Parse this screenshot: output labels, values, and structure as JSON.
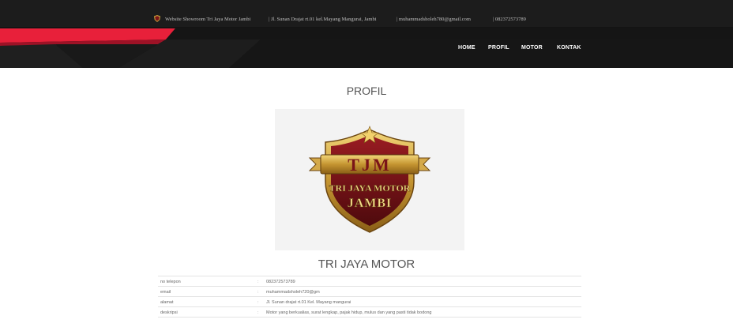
{
  "topbar": {
    "site": "Website Showroom Tri Jaya Motor Jambi",
    "address": "| Jl. Sunan Drajat rt.01 kel.Mayang Mangurai, Jambi",
    "email": "| muhammadsholeh780@gmail.com",
    "phone": "| 082372573789"
  },
  "nav": {
    "items": [
      {
        "label": "HOME"
      },
      {
        "label": "PROFIL"
      },
      {
        "label": "MOTOR"
      },
      {
        "label": "KONTAK"
      }
    ]
  },
  "page": {
    "title": "PROFIL",
    "brand": "TRI JAYA MOTOR"
  },
  "logo": {
    "initials": "TJM",
    "line1": "TRI JAYA MOTOR",
    "line2": "JAMBI"
  },
  "info": {
    "rows": [
      {
        "label": "no telepon",
        "sep": ":",
        "value": "082372573789"
      },
      {
        "label": "email",
        "sep": ":",
        "value": "muhammadsholeh720@gm"
      },
      {
        "label": "alamat",
        "sep": ":",
        "value": "Jl. Sunan drajat rt.01 Kel. Mayang mangurai"
      },
      {
        "label": "deskripsi",
        "sep": ":",
        "value": "Motor yang berkualias, surat lengkap, pajak hidup, mulus dan yang pasti tidak bodong"
      }
    ]
  },
  "colors": {
    "topbar": "#1c1c1c",
    "navbar": "#141414",
    "accent_red": "#e8203a",
    "shield_gold": "#c9a13a",
    "shield_red": "#7a1418"
  }
}
